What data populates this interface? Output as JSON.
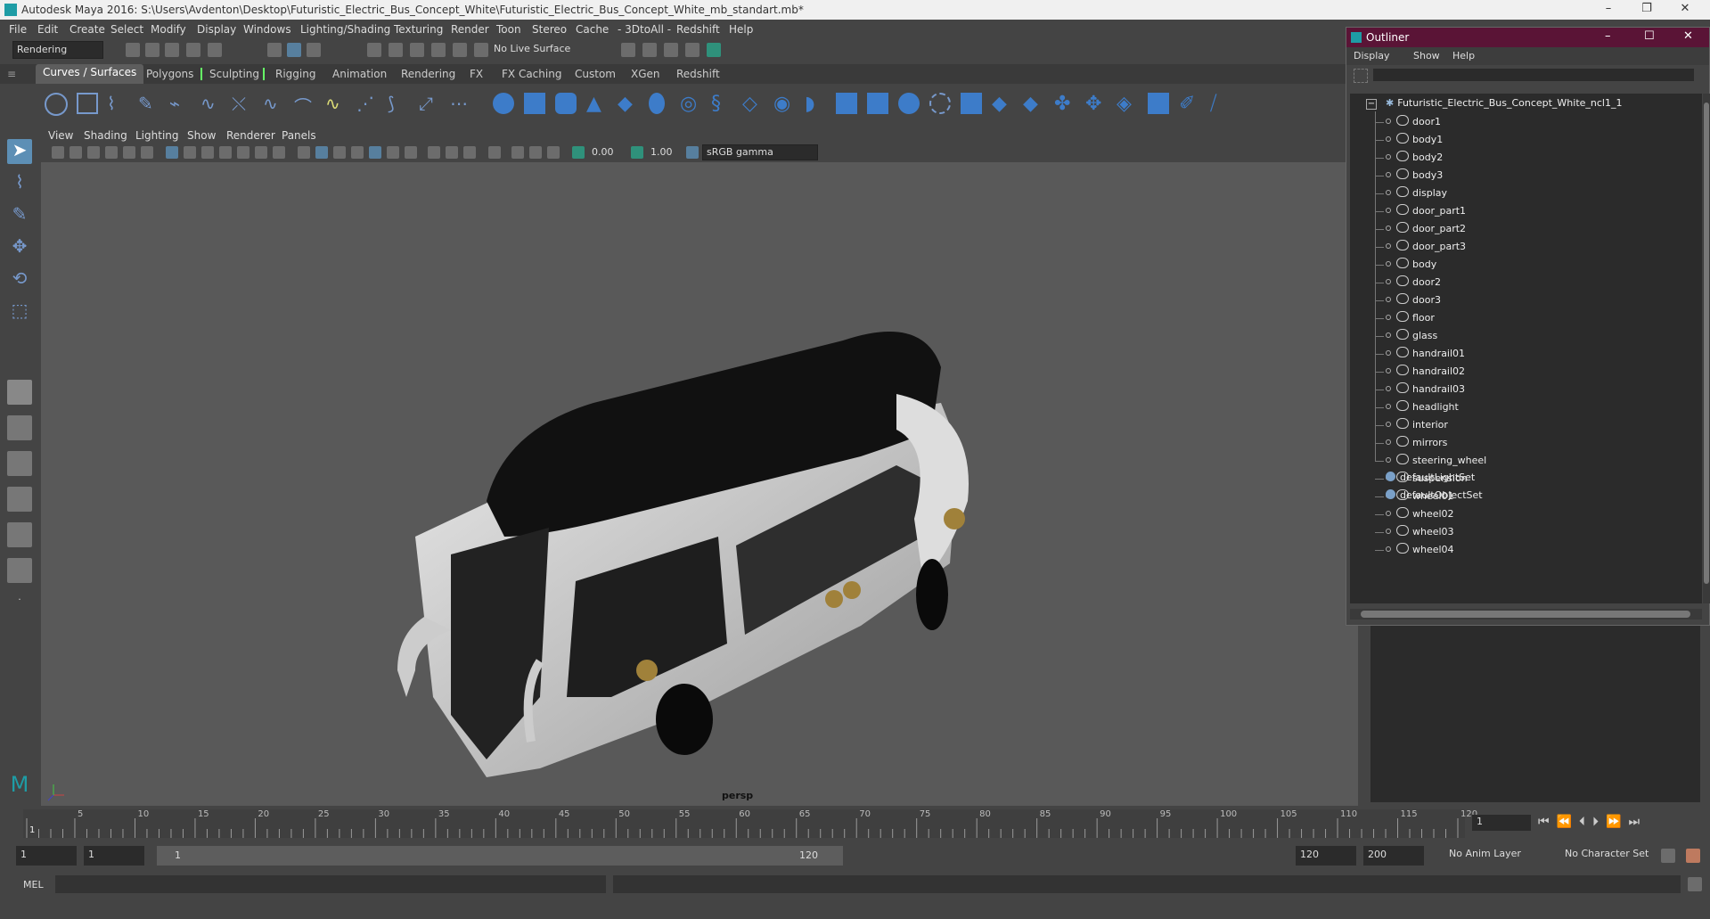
{
  "window": {
    "title": "Autodesk Maya 2016: S:\\Users\\Avdenton\\Desktop\\Futuristic_Electric_Bus_Concept_White\\Futuristic_Electric_Bus_Concept_White_mb_standart.mb*"
  },
  "menubar": [
    "File",
    "Edit",
    "Create",
    "Select",
    "Modify",
    "Display",
    "Windows",
    "Lighting/Shading",
    "Texturing",
    "Render",
    "Toon",
    "Stereo",
    "Cache",
    "- 3DtoAll -",
    "Redshift",
    "Help"
  ],
  "status_line": {
    "mode": "Rendering",
    "live_surface": "No Live Surface"
  },
  "shelf_tabs": [
    "Curves / Surfaces",
    "Polygons",
    "Sculpting",
    "Rigging",
    "Animation",
    "Rendering",
    "FX",
    "FX Caching",
    "Custom",
    "XGen",
    "Redshift"
  ],
  "viewport": {
    "menu": [
      "View",
      "Shading",
      "Lighting",
      "Show",
      "Renderer",
      "Panels"
    ],
    "exposure": "0.00",
    "gamma": "1.00",
    "color_space": "sRGB gamma",
    "camera_label": "persp"
  },
  "timeline": {
    "ticks": [
      "1",
      "5",
      "10",
      "15",
      "20",
      "25",
      "30",
      "35",
      "40",
      "45",
      "50",
      "55",
      "60",
      "65",
      "70",
      "75",
      "80",
      "85",
      "90",
      "95",
      "100",
      "105",
      "110",
      "115",
      "120"
    ],
    "current_frame": "1"
  },
  "range": {
    "start": "1",
    "playback_start": "1",
    "slider_start": "1",
    "slider_end": "120",
    "playback_end": "120",
    "end": "200",
    "anim_layer": "No Anim Layer",
    "character_set": "No Character Set"
  },
  "command_line": {
    "label": "MEL"
  },
  "outliner": {
    "title": "Outliner",
    "menu": [
      "Display",
      "Show",
      "Help"
    ],
    "root": "Futuristic_Electric_Bus_Concept_White_ncl1_1",
    "children": [
      "door1",
      "body1",
      "body2",
      "body3",
      "display",
      "door_part1",
      "door_part2",
      "door_part3",
      "body",
      "door2",
      "door3",
      "floor",
      "glass",
      "handrail01",
      "handrail02",
      "handrail03",
      "headlight",
      "interior",
      "mirrors",
      "steering_wheel",
      "suspension",
      "wheel01",
      "wheel02",
      "wheel03",
      "wheel04"
    ],
    "sets": [
      "defaultLightSet",
      "defaultObjectSet"
    ]
  },
  "colors": {
    "outliner_title": "#5a1436",
    "active_tab": "#5d5d5d",
    "viewport_bg": "#595959",
    "maya_logo": "#1e9ca5"
  }
}
